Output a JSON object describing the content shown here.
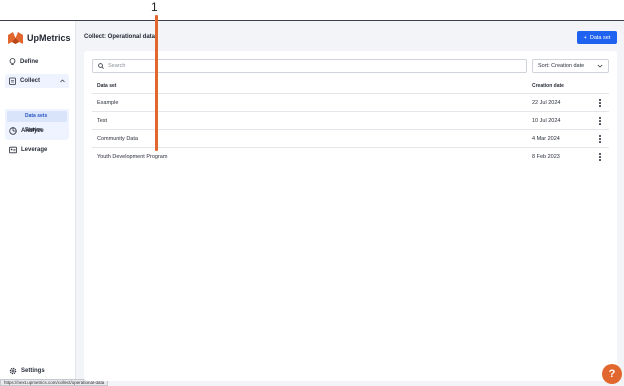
{
  "annotation": {
    "number": "1"
  },
  "brand": {
    "name": "UpMetrics"
  },
  "sidebar": {
    "items": [
      {
        "label": "Define",
        "icon": "bulb-icon"
      },
      {
        "label": "Collect",
        "icon": "clipboard-icon",
        "expanded": true,
        "children": [
          {
            "label": "Data sets",
            "active": true
          },
          {
            "label": "Stories"
          }
        ]
      },
      {
        "label": "Analyze",
        "icon": "pie-icon"
      },
      {
        "label": "Leverage",
        "icon": "id-card-icon"
      }
    ],
    "settings": {
      "label": "Settings",
      "icon": "gear-icon"
    }
  },
  "status_url": "https://next.upmetrics.com/collect/operational-data",
  "header": {
    "title": "Collect: Operational data",
    "add_button": "Data set"
  },
  "search": {
    "placeholder": "Search",
    "value": ""
  },
  "sort": {
    "label": "Sort: Creation date"
  },
  "table": {
    "columns": [
      "Data set",
      "Creation date"
    ],
    "rows": [
      {
        "name": "Example",
        "date": "22 Jul 2024"
      },
      {
        "name": "Test",
        "date": "10 Jul 2024"
      },
      {
        "name": "Community Data",
        "date": "4 Mar 2024"
      },
      {
        "name": "Youth Development Program",
        "date": "8 Feb 2023"
      }
    ]
  },
  "help": {
    "label": "?"
  },
  "colors": {
    "accent": "#1f62f0",
    "annotation": "#e2672e",
    "active_bg": "#eef3ff"
  }
}
